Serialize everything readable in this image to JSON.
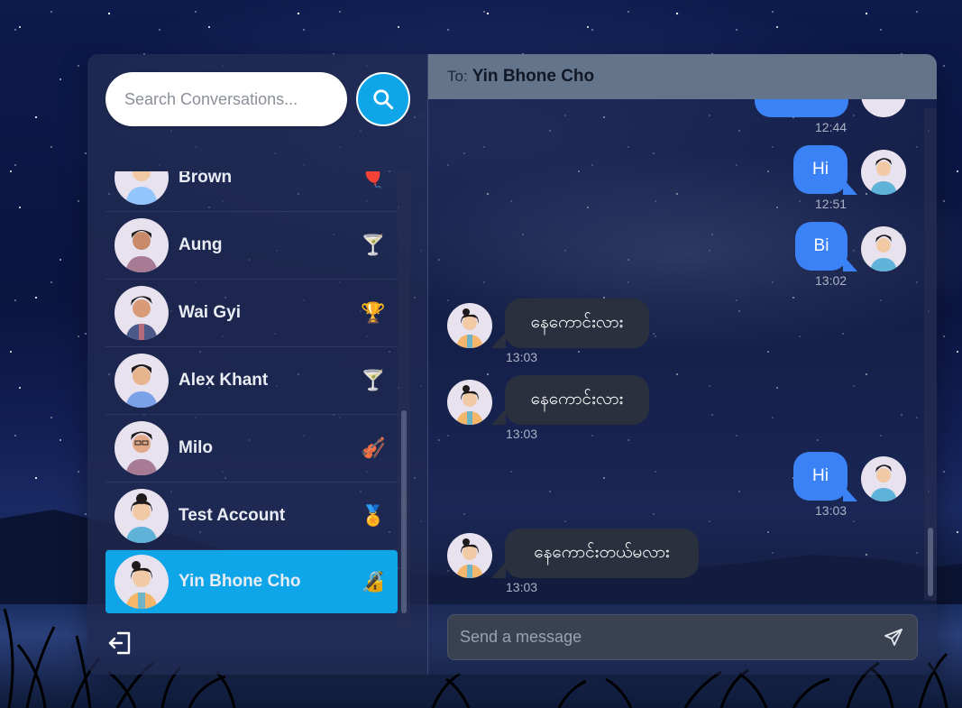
{
  "search": {
    "placeholder": "Search Conversations..."
  },
  "sidebar": {
    "conversations": [
      {
        "name": "Brown",
        "emoji": "🎈"
      },
      {
        "name": "Aung",
        "emoji": "🍸"
      },
      {
        "name": "Wai Gyi",
        "emoji": "🏆"
      },
      {
        "name": "Alex Khant",
        "emoji": "🍸"
      },
      {
        "name": "Milo",
        "emoji": "🎻"
      },
      {
        "name": "Test Account",
        "emoji": "🏅"
      },
      {
        "name": "Yin Bhone Cho",
        "emoji": "🔏",
        "active": true
      }
    ]
  },
  "chat": {
    "to_label": "To:",
    "to_name": "Yin Bhone Cho",
    "messages": [
      {
        "from": "me",
        "text": "",
        "time": "12:44"
      },
      {
        "from": "me",
        "text": "Hi",
        "time": "12:51"
      },
      {
        "from": "me",
        "text": "Bi",
        "time": "13:02"
      },
      {
        "from": "them",
        "text": "နေကောင်းလား",
        "time": "13:03"
      },
      {
        "from": "them",
        "text": "နေကောင်းလား",
        "time": "13:03"
      },
      {
        "from": "me",
        "text": "Hi",
        "time": "13:03"
      },
      {
        "from": "them",
        "text": "နေကောင်းတယ်မလား",
        "time": "13:03"
      }
    ],
    "composer_placeholder": "Send a message"
  },
  "colors": {
    "accent": "#0ea5e9",
    "sent_bubble": "#3b82f6",
    "recv_bubble": "#2a303d",
    "header": "#64748b"
  }
}
